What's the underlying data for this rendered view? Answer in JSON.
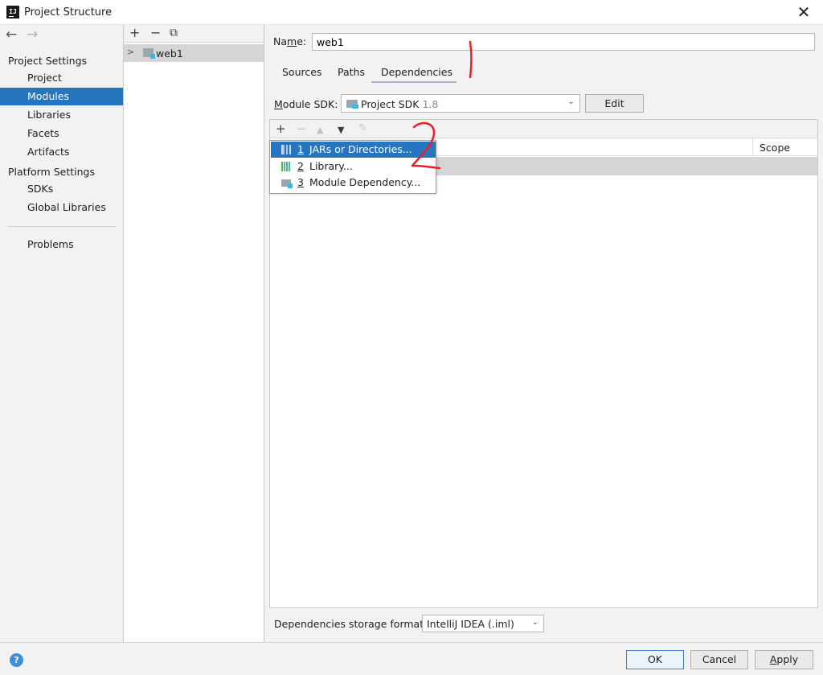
{
  "window": {
    "title": "Project Structure",
    "close_label": "✕"
  },
  "left_nav": {
    "back_icon": "←",
    "forward_icon": "→",
    "project_settings_heading": "Project Settings",
    "project_items": [
      "Project",
      "Modules",
      "Libraries",
      "Facets",
      "Artifacts"
    ],
    "selected_item": "Modules",
    "platform_settings_heading": "Platform Settings",
    "platform_items": [
      "SDKs",
      "Global Libraries"
    ],
    "problems_label": "Problems"
  },
  "modules_panel": {
    "toolbar": {
      "add": "+",
      "remove": "−",
      "copy": "⧉"
    },
    "tree": [
      {
        "label": "web1",
        "expanded": false,
        "selected": true
      }
    ]
  },
  "module_editor": {
    "name_label_first": "Na",
    "name_label_underlined": "m",
    "name_label_rest": "e:",
    "name_value": "web1",
    "tabs": [
      "Sources",
      "Paths",
      "Dependencies"
    ],
    "active_tab": "Dependencies",
    "sdk": {
      "label_underlined": "M",
      "label_rest": "odule SDK:",
      "value": "Project SDK",
      "version": "1.8",
      "edit_label": "Edit"
    },
    "dependencies": {
      "toolbar": {
        "add": "+",
        "remove": "−",
        "move_up": "▲",
        "move_down": "▼",
        "edit": "✎"
      },
      "columns": {
        "scope": "Scope"
      }
    },
    "add_popup": {
      "items": [
        {
          "number": "1",
          "label": "JARs or Directories...",
          "icon": "jar-icon",
          "highlighted": true
        },
        {
          "number": "2",
          "label": "Library...",
          "icon": "library-icon",
          "highlighted": false
        },
        {
          "number": "3",
          "label": "Module Dependency...",
          "icon": "module-dependency-icon",
          "highlighted": false
        }
      ]
    },
    "storage_format": {
      "label": "Dependencies storage format:",
      "value": "IntelliJ IDEA (.iml)"
    }
  },
  "footer": {
    "help": "?",
    "ok": "OK",
    "cancel": "Cancel",
    "apply_underlined": "A",
    "apply_rest": "pply"
  },
  "annotations": [
    {
      "text": "1",
      "color": "#e8202a"
    },
    {
      "text": "2",
      "color": "#e8202a"
    }
  ],
  "colors": {
    "selection": "#2675bf",
    "annotation": "#e8202a",
    "accent_blue": "#40b6e0"
  }
}
